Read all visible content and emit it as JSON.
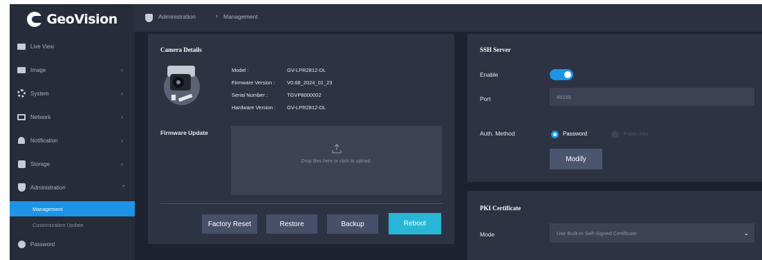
{
  "app": {
    "brand": "GeoVision"
  },
  "breadcrumb": {
    "root": "Administration",
    "separator": "›",
    "current": "Management"
  },
  "sidebar": {
    "items": [
      {
        "label": "Live View",
        "icon": "live-view-icon"
      },
      {
        "label": "Image",
        "icon": "image-icon",
        "arrow": "›"
      },
      {
        "label": "System",
        "icon": "gear-icon",
        "arrow": "›"
      },
      {
        "label": "Network",
        "icon": "monitor-icon",
        "arrow": "›"
      },
      {
        "label": "Notification",
        "icon": "bell-icon",
        "arrow": "›"
      },
      {
        "label": "Storage",
        "icon": "storage-icon",
        "arrow": "›"
      },
      {
        "label": "Administration",
        "icon": "shield-icon",
        "arrow": "⌄"
      }
    ],
    "subitems": [
      {
        "label": "Management",
        "active": true
      },
      {
        "label": "Customization Update",
        "active": false
      }
    ],
    "last_item": {
      "label": "Password",
      "icon": "user-icon"
    }
  },
  "camera_details": {
    "title": "Camera Details",
    "fields": [
      {
        "label": "Model :",
        "value": "GV-LPR2812-DL"
      },
      {
        "label": "Firmware Version :",
        "value": "V0.68_2024_01_23"
      },
      {
        "label": "Serial Number :",
        "value": "TGVP8000002"
      },
      {
        "label": "Hardware Version :",
        "value": "GV-LPR2812-DL"
      }
    ],
    "firmware_label": "Firmware Update",
    "upload_text": "Drop files here or click to upload.",
    "buttons": {
      "factory_reset": "Factory Reset",
      "restore": "Restore",
      "backup": "Backup",
      "reboot": "Reboot"
    }
  },
  "ssh": {
    "title": "SSH Server",
    "enable_label": "Enable",
    "enabled": true,
    "port_label": "Port",
    "port_value": "49155",
    "auth_label": "Auth. Method",
    "auth_options": [
      "Password",
      "Public Key"
    ],
    "auth_selected": "Password",
    "modify_label": "Modify"
  },
  "pki": {
    "title": "PKI Certificate",
    "mode_label": "Mode",
    "mode_value": "Use Built-In Self-Signed Certificate"
  },
  "colors": {
    "accent": "#1e94e6",
    "reboot": "#29b6d6",
    "panel": "#2d3342",
    "background": "#1c2230"
  }
}
